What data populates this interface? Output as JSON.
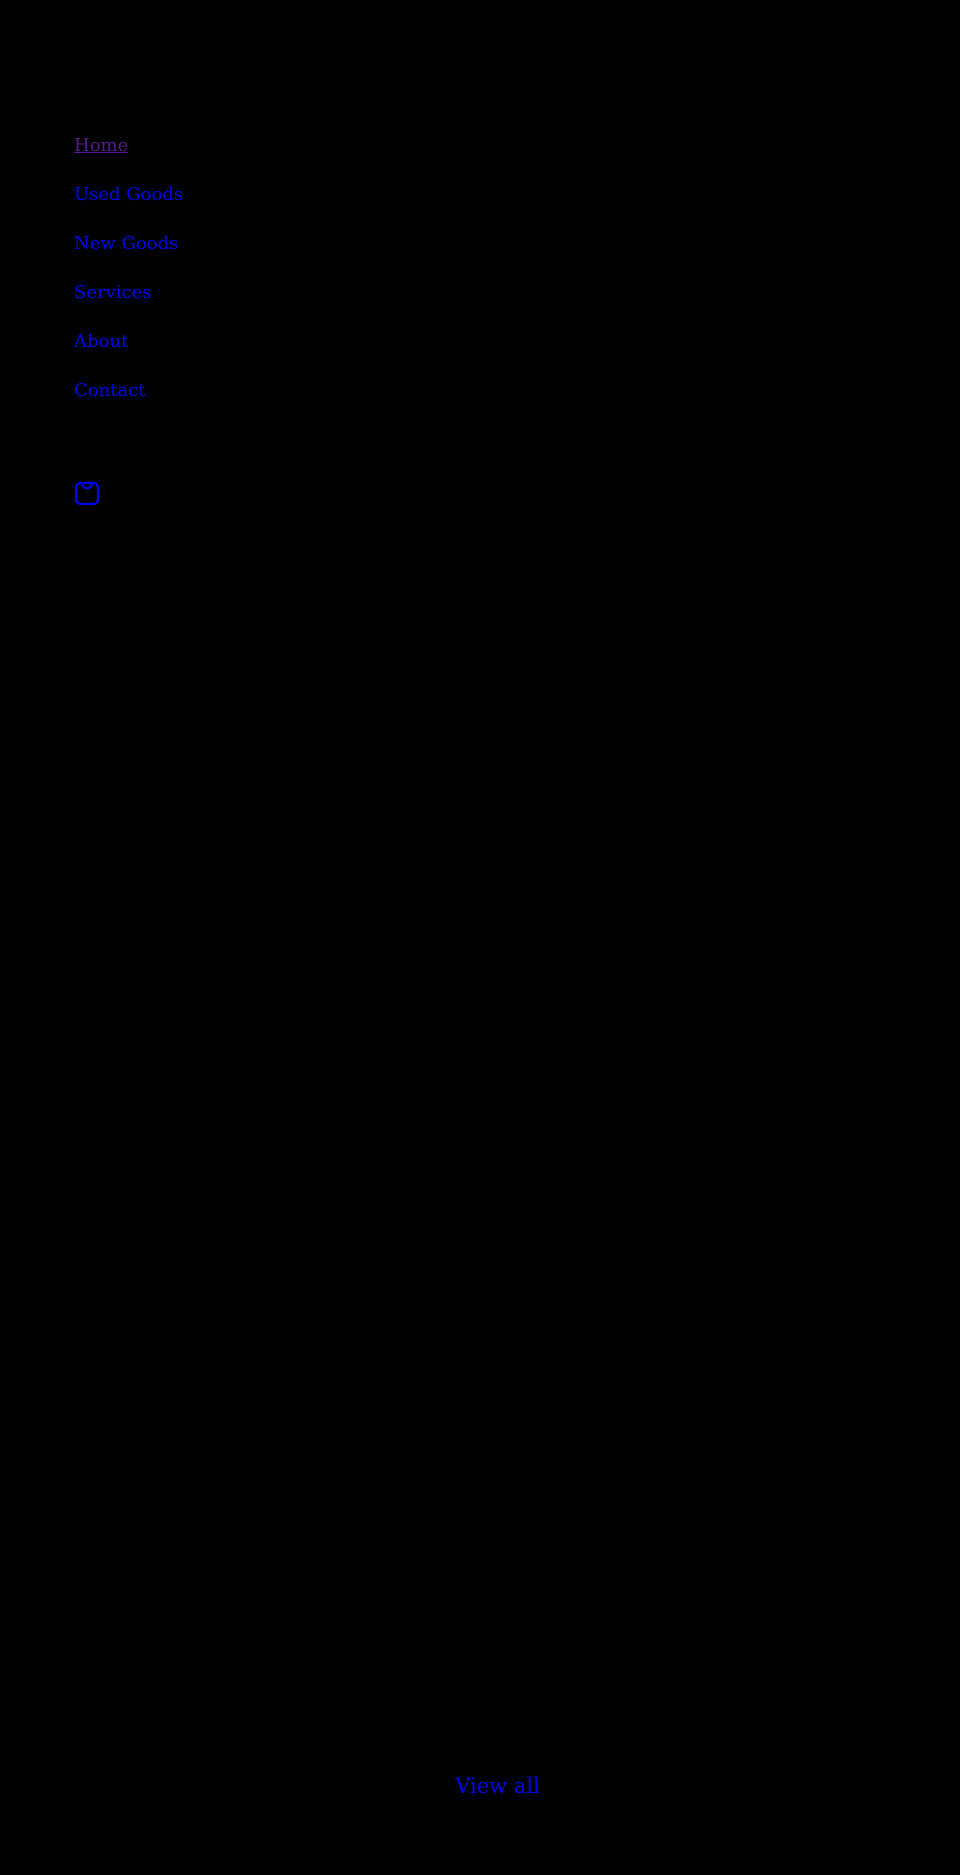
{
  "nav": {
    "items": [
      {
        "label": "Home"
      },
      {
        "label": "Used Goods"
      },
      {
        "label": "New Goods"
      },
      {
        "label": "Services"
      },
      {
        "label": "About"
      },
      {
        "label": "Contact"
      }
    ]
  },
  "cart": {
    "icon": "shopping-bag-icon"
  },
  "collection": {
    "view_all_label": "View all"
  },
  "colors": {
    "background": "#000000",
    "link": "#0000ee",
    "visited_link": "#551a8b"
  }
}
